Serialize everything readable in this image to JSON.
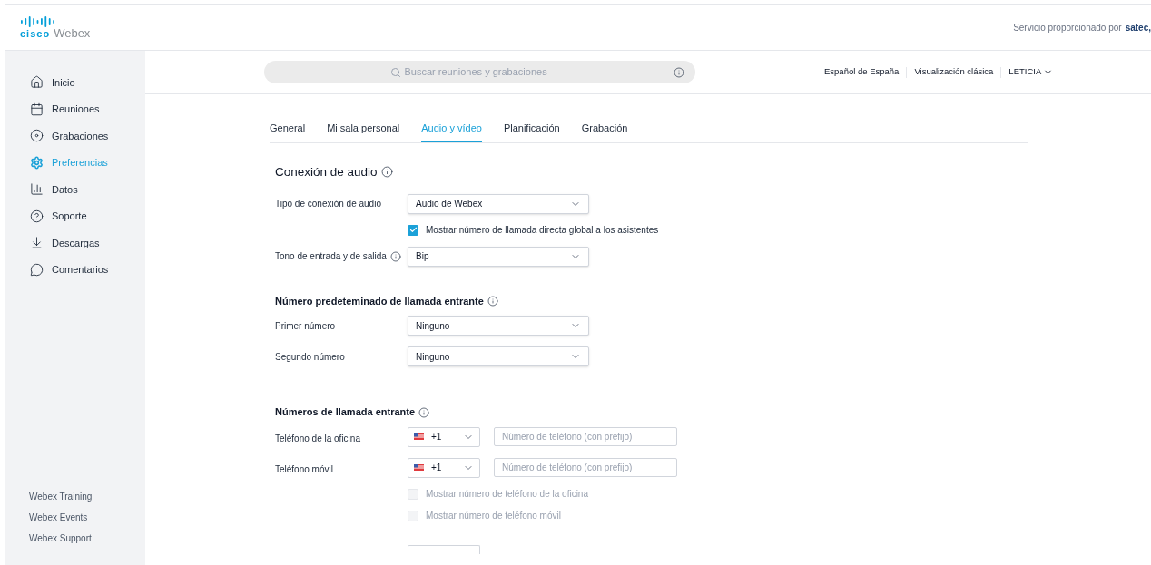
{
  "header": {
    "wordmark": "cisco",
    "brand": "Webex",
    "provider_label": "Servicio proporcionado por",
    "provider_name": "satec,"
  },
  "sidebar": {
    "items": [
      {
        "label": "Inicio",
        "selected": false
      },
      {
        "label": "Reuniones",
        "selected": false
      },
      {
        "label": "Grabaciones",
        "selected": false
      },
      {
        "label": "Preferencias",
        "selected": true
      },
      {
        "label": "Datos",
        "selected": false
      },
      {
        "label": "Soporte",
        "selected": false
      },
      {
        "label": "Descargas",
        "selected": false
      },
      {
        "label": "Comentarios",
        "selected": false
      }
    ],
    "footer_links": [
      "Webex Training",
      "Webex Events",
      "Webex Support"
    ]
  },
  "search": {
    "placeholder": "Buscar reuniones y grabaciones"
  },
  "top_links": [
    "Español de España",
    "Visualización clásica"
  ],
  "user": "LETICIA",
  "tabs": [
    {
      "label": "General",
      "selected": false
    },
    {
      "label": "Mi sala personal",
      "selected": false
    },
    {
      "label": "Audio y vídeo",
      "selected": true
    },
    {
      "label": "Planificación",
      "selected": false
    },
    {
      "label": "Grabación",
      "selected": false
    }
  ],
  "sections": [
    {
      "title": "Conexión de audio",
      "rows": [
        {
          "kind": "select",
          "label": "Tipo de conexión de audio",
          "info": false,
          "value": "Audio de Webex"
        },
        {
          "kind": "checkbox",
          "label": "Mostrar número de llamada directa global a los asistentes",
          "checked": true,
          "disabled": false
        },
        {
          "kind": "select",
          "label": "Tono de entrada y de salida",
          "info": true,
          "value": "Bip"
        }
      ]
    },
    {
      "title": "Número predeteminado de llamada entrante",
      "rows": [
        {
          "kind": "select",
          "label": "Primer número",
          "info": false,
          "value": "Ninguno"
        },
        {
          "kind": "select",
          "label": "Segundo número",
          "info": false,
          "value": "Ninguno"
        }
      ]
    },
    {
      "title": "Números de llamada entrante",
      "rows": [
        {
          "kind": "phone",
          "label": "Teléfono de la oficina",
          "code": "+1",
          "placeholder": "Número de teléfono (con prefijo)"
        },
        {
          "kind": "phone",
          "label": "Teléfono móvil",
          "code": "+1",
          "placeholder": "Número de teléfono (con prefijo)"
        },
        {
          "kind": "checkbox",
          "label": "Mostrar número de teléfono de la oficina",
          "checked": false,
          "disabled": true
        },
        {
          "kind": "checkbox",
          "label": "Mostrar número de teléfono móvil",
          "checked": false,
          "disabled": true
        },
        {
          "kind": "blank"
        }
      ]
    }
  ]
}
